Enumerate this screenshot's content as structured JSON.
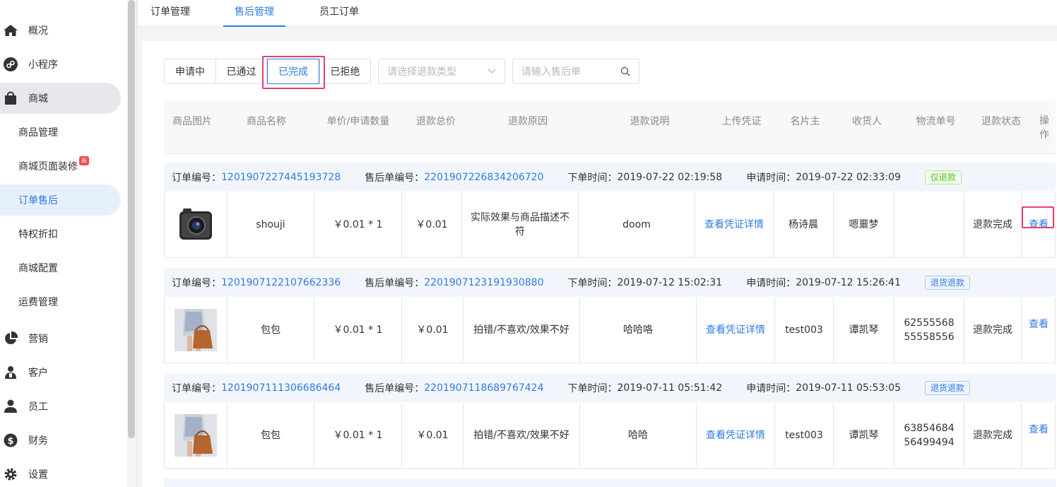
{
  "sidebar": {
    "items": [
      {
        "label": "概况",
        "icon": "home-icon"
      },
      {
        "label": "小程序",
        "icon": "mini-program-icon"
      },
      {
        "label": "商城",
        "icon": "shopping-bag-icon"
      },
      {
        "label": "商品管理"
      },
      {
        "label": "商城页面装修",
        "badge": "新"
      },
      {
        "label": "订单售后"
      },
      {
        "label": "特权折扣"
      },
      {
        "label": "商城配置"
      },
      {
        "label": "运费管理"
      },
      {
        "label": "营销",
        "icon": "pie-chart-icon"
      },
      {
        "label": "客户",
        "icon": "customer-icon"
      },
      {
        "label": "员工",
        "icon": "user-icon"
      },
      {
        "label": "财务",
        "icon": "dollar-icon"
      },
      {
        "label": "设置",
        "icon": "gear-icon"
      }
    ]
  },
  "tabs": [
    "订单管理",
    "售后管理",
    "员工订单"
  ],
  "filters": {
    "status": [
      "申请中",
      "已通过",
      "已完成",
      "已拒绝"
    ],
    "refund_type_placeholder": "请选择退款类型",
    "search_placeholder": "请输入售后单"
  },
  "table": {
    "headers": [
      "商品图片",
      "商品名称",
      "单价/申请数量",
      "退款总价",
      "退款原因",
      "退款说明",
      "上传凭证",
      "名片主",
      "收货人",
      "物流单号",
      "退款状态",
      "操作"
    ],
    "order_no_label": "订单编号：",
    "aftersale_no_label": "售后单编号：",
    "order_time_label": "下单时间：",
    "apply_time_label": "申请时间：",
    "orders": [
      {
        "order_no": "1201907227445193728",
        "aftersale_no": "2201907226834206720",
        "order_time": "2019-07-22 02:19:58",
        "apply_time": "2019-07-22 02:33:09",
        "badge": "仅退款",
        "product_name": "shouji",
        "price_qty": "￥0.01 * 1",
        "total": "￥0.01",
        "reason": "实际效果与商品描述不符",
        "description": "doom",
        "voucher": "查看凭证详情",
        "card_owner": "杨诗晨",
        "receiver": "嗯噩梦",
        "logistics": "",
        "status": "退款完成",
        "action": "查看"
      },
      {
        "order_no": "1201907122107662336",
        "aftersale_no": "2201907123191930880",
        "order_time": "2019-07-12 15:02:31",
        "apply_time": "2019-07-12 15:26:41",
        "badge": "退货退款",
        "product_name": "包包",
        "price_qty": "￥0.01 * 1",
        "total": "￥0.01",
        "reason": "拍错/不喜欢/效果不好",
        "description": "哈哈咯",
        "voucher": "查看凭证详情",
        "card_owner": "test003",
        "receiver": "谭凯琴",
        "logistics": "6255556855558556",
        "status": "退款完成",
        "action": "查看"
      },
      {
        "order_no": "1201907111306686464",
        "aftersale_no": "2201907118689767424",
        "order_time": "2019-07-11 05:51:42",
        "apply_time": "2019-07-11 05:53:05",
        "badge": "退货退款",
        "product_name": "包包",
        "price_qty": "￥0.01 * 1",
        "total": "￥0.01",
        "reason": "拍错/不喜欢/效果不好",
        "description": "哈哈",
        "voucher": "查看凭证详情",
        "card_owner": "test003",
        "receiver": "谭凯琴",
        "logistics": "6385468456499494",
        "status": "退款完成",
        "action": "查看"
      }
    ]
  }
}
